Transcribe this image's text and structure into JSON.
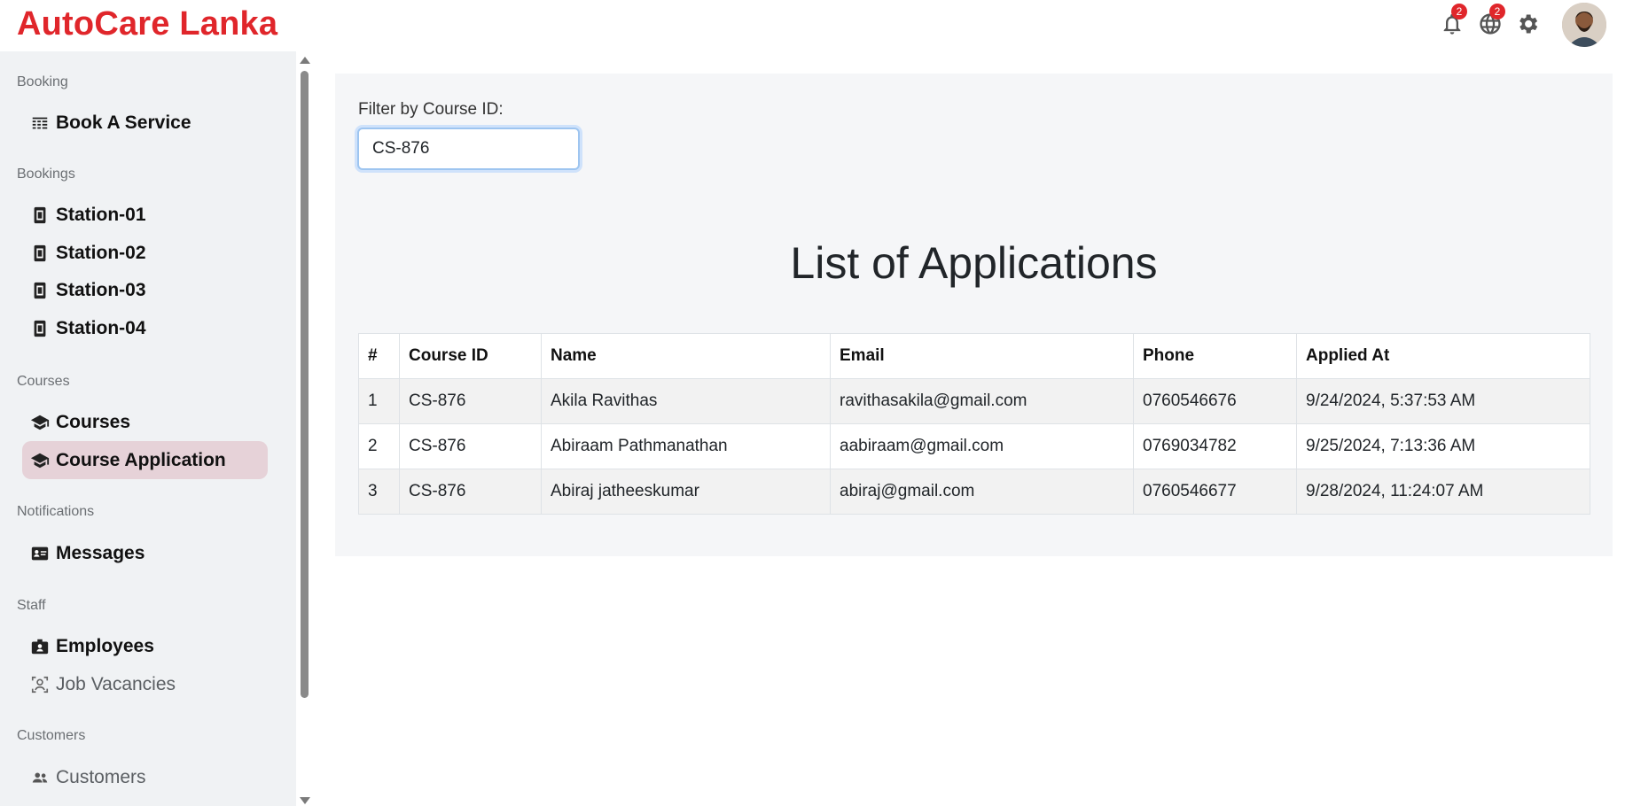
{
  "header": {
    "brand": "AutoCare Lanka",
    "notifications_count": "2",
    "language_count": "2"
  },
  "sidebar": {
    "sections": {
      "booking": "Booking",
      "bookings": "Bookings",
      "courses": "Courses",
      "notifications": "Notifications",
      "staff": "Staff",
      "customers": "Customers"
    },
    "items": {
      "book_service": "Book A Service",
      "station1": "Station-01",
      "station2": "Station-02",
      "station3": "Station-03",
      "station4": "Station-04",
      "courses": "Courses",
      "course_application": "Course Application",
      "messages": "Messages",
      "employees": "Employees",
      "job_vacancies": "Job Vacancies",
      "customers": "Customers"
    }
  },
  "main": {
    "filter_label": "Filter by Course ID:",
    "filter_value": "CS-876",
    "title": "List of Applications",
    "columns": [
      "#",
      "Course ID",
      "Name",
      "Email",
      "Phone",
      "Applied At"
    ],
    "rows": [
      [
        "1",
        "CS-876",
        "Akila Ravithas",
        "ravithasakila@gmail.com",
        "0760546676",
        "9/24/2024, 5:37:53 AM"
      ],
      [
        "2",
        "CS-876",
        "Abiraam Pathmanathan",
        "aabiraam@gmail.com",
        "0769034782",
        "9/25/2024, 7:13:36 AM"
      ],
      [
        "3",
        "CS-876",
        "Abiraj jatheeskumar",
        "abiraj@gmail.com",
        "0760546677",
        "9/28/2024, 11:24:07 AM"
      ]
    ]
  },
  "colors": {
    "brand": "#e0262b",
    "active_item": "#e6d2d8",
    "sidebar_bg": "#f0f2f4"
  }
}
